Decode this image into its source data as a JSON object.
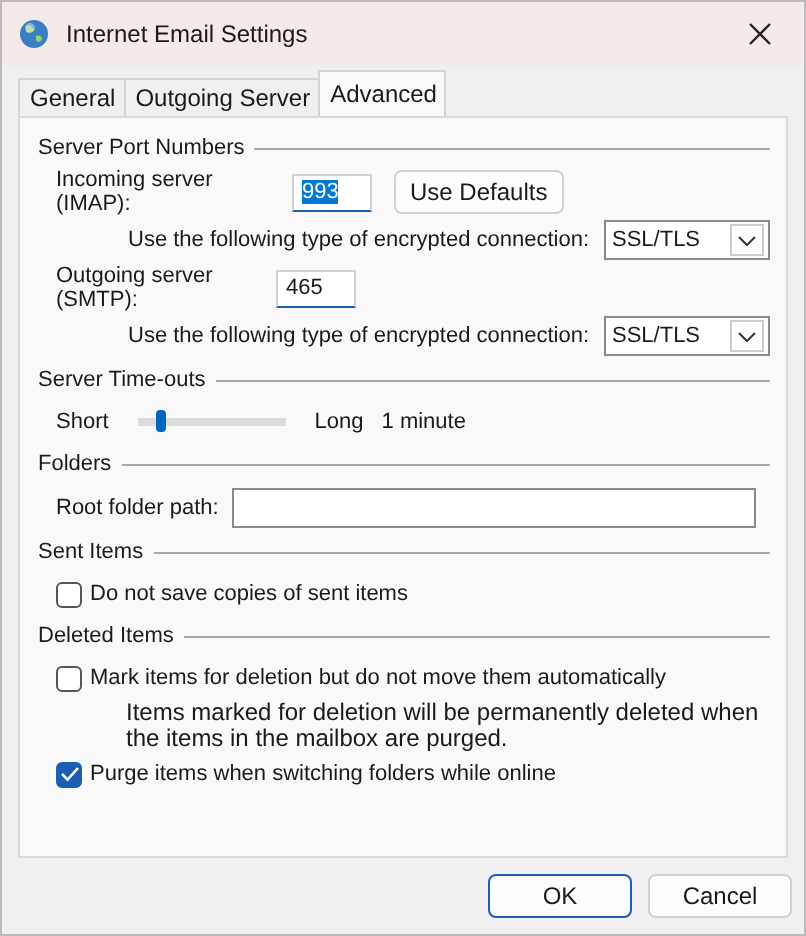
{
  "window": {
    "title": "Internet Email Settings"
  },
  "tabs": [
    {
      "label": "General",
      "selected": false
    },
    {
      "label": "Outgoing Server",
      "selected": false
    },
    {
      "label": "Advanced",
      "selected": true
    }
  ],
  "server_ports": {
    "heading": "Server Port Numbers",
    "incoming": {
      "label": "Incoming server (IMAP):",
      "value": "993",
      "selected": true
    },
    "use_defaults_button": "Use Defaults",
    "incoming_encryption": {
      "label": "Use the following type of encrypted connection:",
      "value": "SSL/TLS"
    },
    "outgoing": {
      "label": "Outgoing server (SMTP):",
      "value": "465",
      "selected": false
    },
    "outgoing_encryption": {
      "label": "Use the following type of encrypted connection:",
      "value": "SSL/TLS"
    }
  },
  "timeouts": {
    "heading": "Server Time-outs",
    "short_label": "Short",
    "level": 0.12,
    "long_label": "Long",
    "reading": "1 minute"
  },
  "folders": {
    "heading": "Folders",
    "root_label": "Root folder path:"
  },
  "sent_items": {
    "heading": "Sent Items",
    "options": [
      {
        "label": "Do not save copies of sent items",
        "checked": false
      }
    ]
  },
  "deleted_items": {
    "heading": "Deleted Items",
    "options": [
      {
        "label": "Mark items for deletion but do not move them automatically",
        "checked": false,
        "note": "Items marked for deletion will be permanently deleted when the items in the mailbox are purged."
      },
      {
        "label": "Purge items when switching folders while online",
        "checked": true
      }
    ]
  },
  "buttons": [
    "OK",
    "Cancel"
  ]
}
